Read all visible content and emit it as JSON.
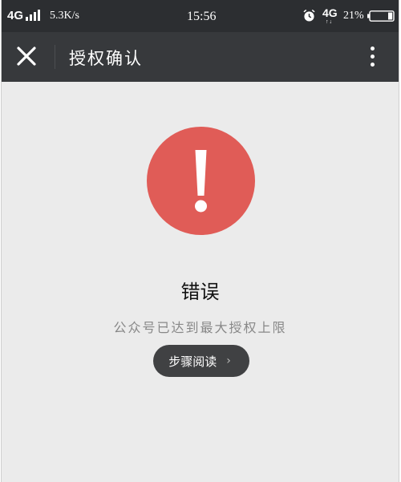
{
  "status_bar": {
    "network": "4G",
    "speed": "5.3K/s",
    "time": "15:56",
    "network2": "4G",
    "network2_arrows": "↑↓",
    "battery": "21%"
  },
  "title_bar": {
    "title": "授权确认",
    "close_icon": "close-icon",
    "more_icon": "more-vertical-icon"
  },
  "content": {
    "icon": "exclamation-icon",
    "icon_color": "#e05c57",
    "title": "错误",
    "description": "公众号已达到最大授权上限",
    "button_label": "步骤阅读",
    "button_chevron": "›"
  }
}
